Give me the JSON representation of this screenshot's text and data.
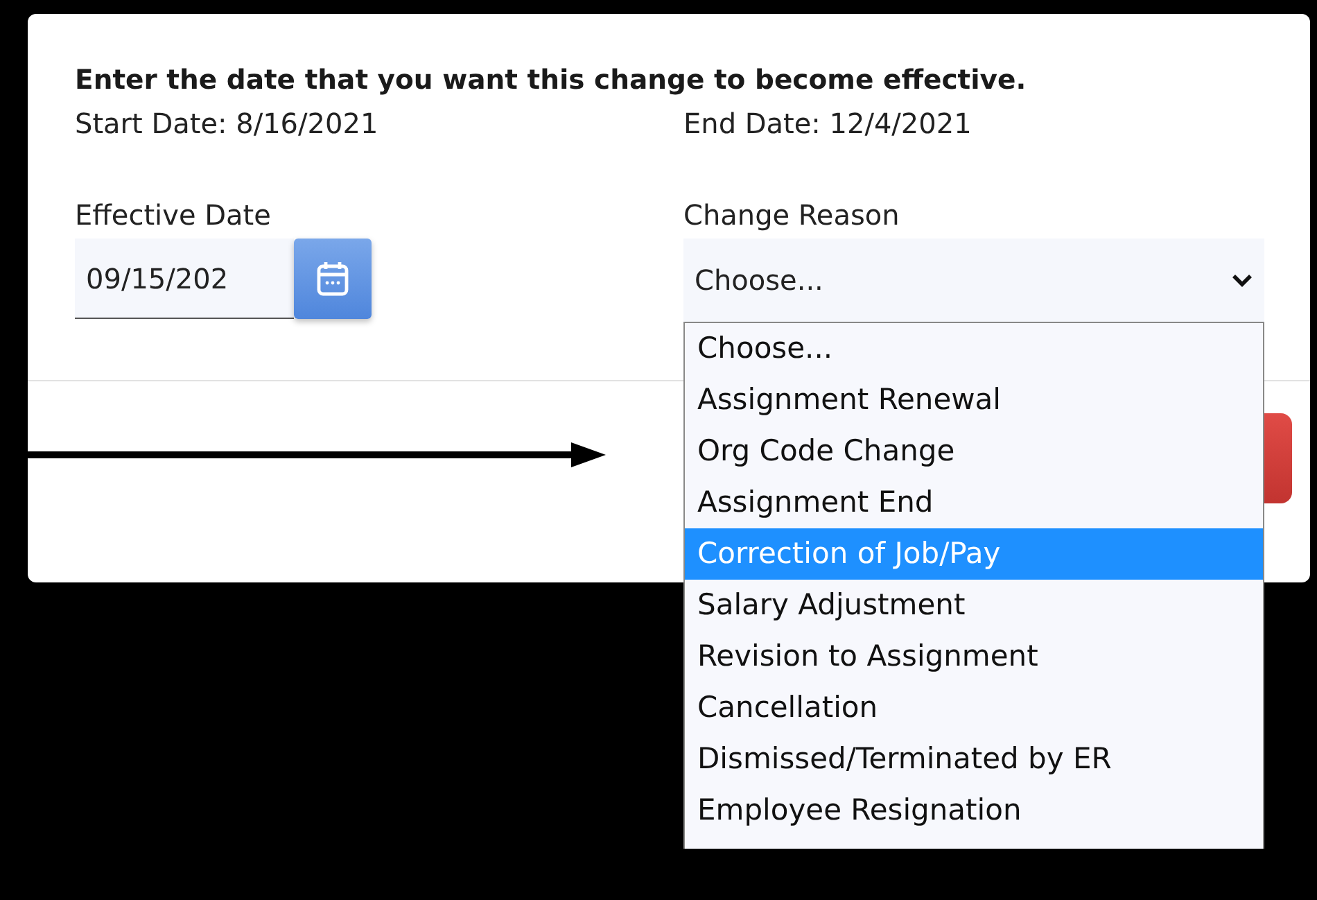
{
  "dialog": {
    "instruction": "Enter the date that you want this change to become effective.",
    "start_date": "Start Date: 8/16/2021",
    "end_date": "End Date: 12/4/2021",
    "effective_date": {
      "label": "Effective Date",
      "value": "09/15/202"
    },
    "change_reason": {
      "label": "Change Reason",
      "value": "Choose...",
      "expanded": true,
      "options": [
        {
          "label": "Choose...",
          "highlighted": false
        },
        {
          "label": "Assignment Renewal",
          "highlighted": false
        },
        {
          "label": "Org Code Change",
          "highlighted": false
        },
        {
          "label": "Assignment End",
          "highlighted": false
        },
        {
          "label": "Correction of Job/Pay",
          "highlighted": true
        },
        {
          "label": "Salary Adjustment",
          "highlighted": false
        },
        {
          "label": "Revision to Assignment",
          "highlighted": false
        },
        {
          "label": "Cancellation",
          "highlighted": false
        },
        {
          "label": "Dismissed/Terminated by ER",
          "highlighted": false
        },
        {
          "label": "Employee Resignation",
          "highlighted": false
        }
      ]
    }
  }
}
